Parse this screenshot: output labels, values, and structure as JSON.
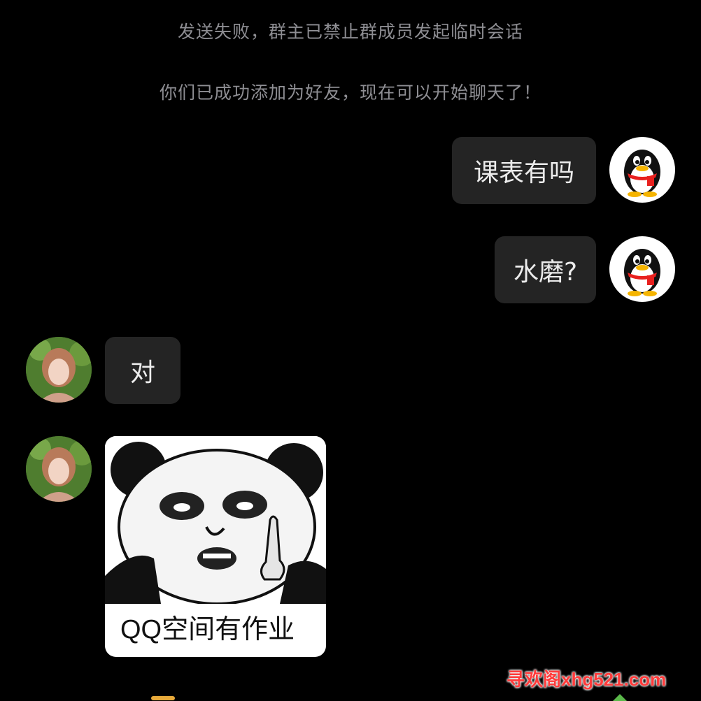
{
  "system_messages": [
    "发送失败，群主已禁止群成员发起临时会话",
    "你们已成功添加为好友，现在可以开始聊天了！"
  ],
  "messages": [
    {
      "sender": "me",
      "text": "课表有吗"
    },
    {
      "sender": "me",
      "text": "水磨?"
    },
    {
      "sender": "other",
      "text": "对"
    },
    {
      "sender": "other",
      "type": "sticker",
      "caption": "QQ空间有作业"
    }
  ],
  "icons": {
    "my_avatar": "qq-penguin-icon",
    "other_avatar": "user-photo-avatar"
  },
  "colors": {
    "background": "#000000",
    "bubble": "#242424",
    "bubble_text": "#ececec",
    "system_text": "#8e8e93"
  },
  "watermark": "寻欢阁xhg521.com"
}
